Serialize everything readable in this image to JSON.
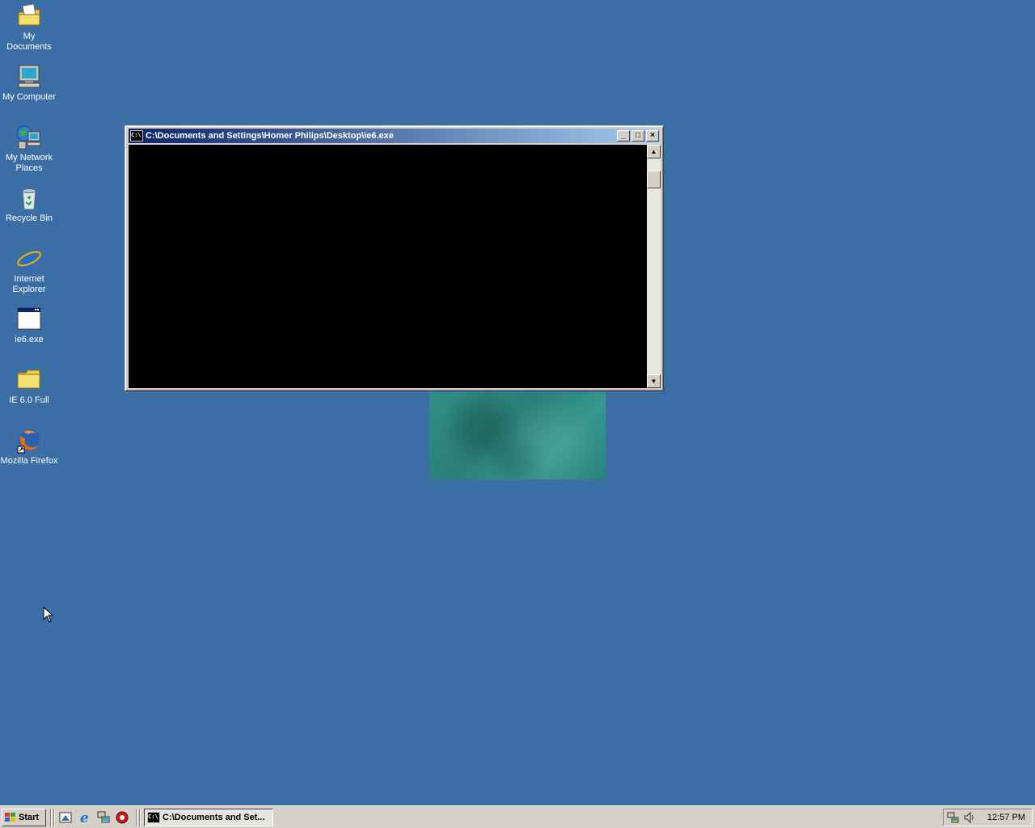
{
  "desktop": {
    "icons": [
      {
        "label": "My Documents",
        "icon": "my-documents-icon"
      },
      {
        "label": "My Computer",
        "icon": "my-computer-icon"
      },
      {
        "label": "My Network\nPlaces",
        "icon": "network-places-icon"
      },
      {
        "label": "Recycle Bin",
        "icon": "recycle-bin-icon"
      },
      {
        "label": "Internet\nExplorer",
        "icon": "internet-explorer-icon"
      },
      {
        "label": "ie6.exe",
        "icon": "application-icon"
      },
      {
        "label": "IE 6.0 Full",
        "icon": "folder-icon"
      },
      {
        "label": "Mozilla Firefox",
        "icon": "firefox-icon"
      }
    ],
    "background_color": "#3a6ea5"
  },
  "window": {
    "title": "C:\\Documents and Settings\\Homer Philips\\Desktop\\ie6.exe",
    "icon_text": "C:\\",
    "minimize_label": "_",
    "maximize_label": "□",
    "close_label": "×",
    "console_background": "#000000"
  },
  "taskbar": {
    "start_label": "Start",
    "quick_launch": [
      "show-desktop-icon",
      "internet-explorer-icon",
      "network-icon",
      "media-icon"
    ],
    "task_button_label": "C:\\Documents and Set...",
    "clock": "12:57 PM"
  }
}
